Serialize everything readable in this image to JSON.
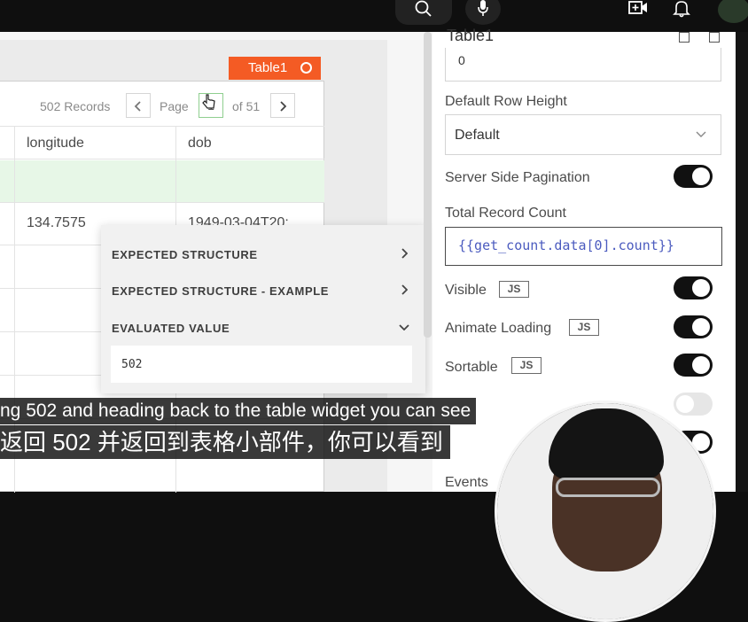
{
  "topbar": {
    "icons": [
      "search-icon",
      "mic-icon",
      "create-video-icon",
      "notifications-bell-icon",
      "account-avatar"
    ]
  },
  "table": {
    "tag_label": "Table1",
    "records_label": "502 Records",
    "page_label": "Page",
    "page_value": "1",
    "of_pages": "of 51",
    "columns": [
      "longitude",
      "dob"
    ],
    "rows": [
      {
        "longitude": "",
        "dob": ""
      },
      {
        "longitude": "134.7575",
        "dob": "1949-03-04T20:"
      }
    ]
  },
  "eval_popup": {
    "sections": [
      "EXPECTED STRUCTURE",
      "EXPECTED STRUCTURE - EXAMPLE",
      "EVALUATED VALUE"
    ],
    "value": "502"
  },
  "property_pane": {
    "title": "Table1",
    "top_input_value": "0",
    "default_row_height_label": "Default Row Height",
    "default_row_height_value": "Default",
    "server_side_pagination_label": "Server Side Pagination",
    "total_record_count_label": "Total Record Count",
    "total_record_count_value": "{{get_count.data[0].count}}",
    "visible_label": "Visible",
    "animate_loading_label": "Animate Loading",
    "sortable_label": "Sortable",
    "js_badge": "JS",
    "events_label": "Events",
    "toggles": {
      "server_side_pagination": true,
      "visible": true,
      "animate_loading": true,
      "sortable": true,
      "partially_hidden": false
    }
  },
  "subtitles": {
    "en": "ng 502 and heading back to the table widget you can see",
    "zh": "返回 502 并返回到表格小部件，你可以看到"
  }
}
